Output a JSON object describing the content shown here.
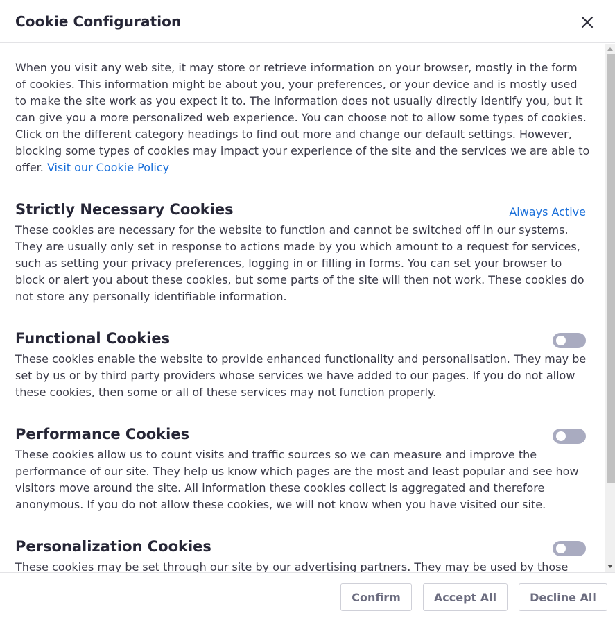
{
  "dialog": {
    "title": "Cookie Configuration",
    "close_icon": "close-icon"
  },
  "intro": {
    "text": "When you visit any web site, it may store or retrieve information on your browser, mostly in the form of cookies. This information might be about you, your preferences, or your device and is mostly used to make the site work as you expect it to. The information does not usually directly identify you, but it can give you a more personalized web experience. You can choose not to allow some types of cookies. Click on the different category headings to find out more and change our default settings. However, blocking some types of cookies may impact your experience of the site and the services we are able to offer.",
    "link_label": "Visit our Cookie Policy"
  },
  "sections": [
    {
      "title": "Strictly Necessary Cookies",
      "status_label": "Always Active",
      "description": "These cookies are necessary for the website to function and cannot be switched off in our systems. They are usually only set in response to actions made by you which amount to a request for services, such as setting your privacy preferences, logging in or filling in forms. You can set your browser to block or alert you about these cookies, but some parts of the site will then not work. These cookies do not store any personally identifiable information."
    },
    {
      "title": "Functional Cookies",
      "enabled": false,
      "description": "These cookies enable the website to provide enhanced functionality and personalisation. They may be set by us or by third party providers whose services we have added to our pages. If you do not allow these cookies, then some or all of these services may not function properly."
    },
    {
      "title": "Performance Cookies",
      "enabled": false,
      "description": "These cookies allow us to count visits and traffic sources so we can measure and improve the performance of our site. They help us know which pages are the most and least popular and see how visitors move around the site. All information these cookies collect is aggregated and therefore anonymous. If you do not allow these cookies, we will not know when you have visited our site."
    },
    {
      "title": "Personalization Cookies",
      "enabled": false,
      "description": "These cookies may be set through our site by our advertising partners. They may be used by those"
    }
  ],
  "footer": {
    "confirm_label": "Confirm",
    "accept_all_label": "Accept All",
    "decline_all_label": "Decline All"
  },
  "colors": {
    "link": "#1a6fd9",
    "toggle_off": "#a9abc0",
    "button_text": "#6c6d80"
  }
}
